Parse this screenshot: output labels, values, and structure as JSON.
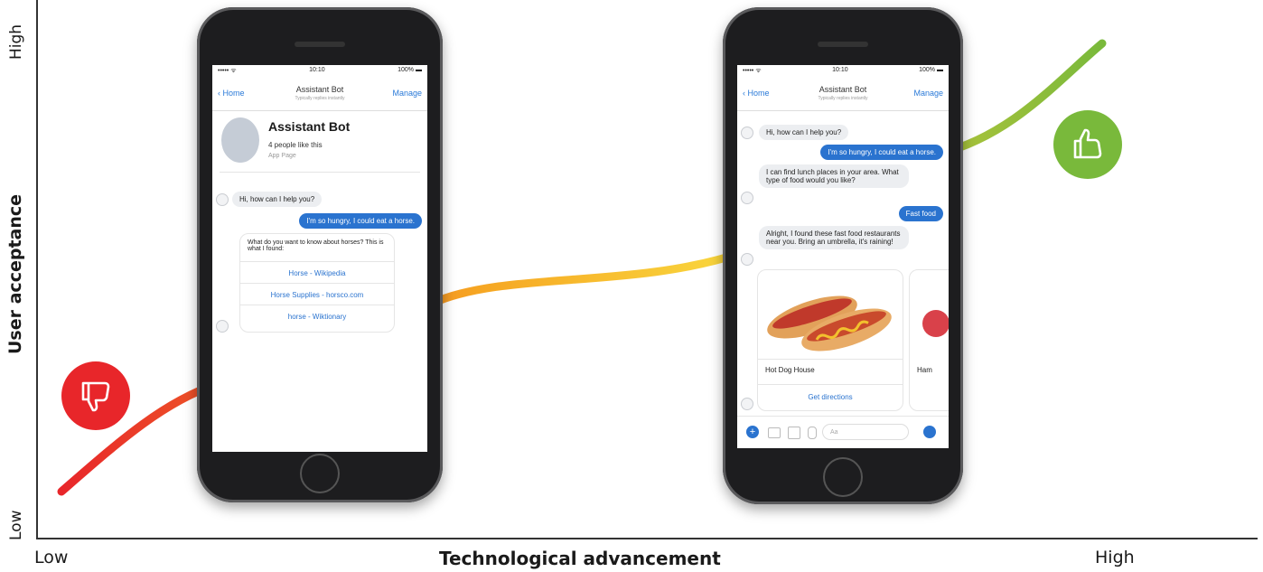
{
  "axes": {
    "y_title": "User acceptance",
    "y_low": "Low",
    "y_high": "High",
    "x_title": "Technological advancement",
    "x_low": "Low",
    "x_high": "High"
  },
  "badges": {
    "low_icon": "thumbs-down-icon",
    "high_icon": "thumbs-up-icon",
    "low_color": "#e8262a",
    "high_color": "#79b93b"
  },
  "curve_colors": [
    "#e8262a",
    "#f6a623",
    "#f9d23b",
    "#79b93b"
  ],
  "phone1": {
    "carrier": "••••• ᯤ",
    "time": "10:10",
    "battery": "100% ▬",
    "back": "‹ Home",
    "title": "Assistant Bot",
    "subtitle": "Typically replies instantly",
    "manage": "Manage",
    "profile_name": "Assistant Bot",
    "profile_likes": "4 people like this",
    "profile_category": "App Page",
    "messages": [
      "Hi, how can I help you?",
      "I'm so hungry, I could eat a horse.",
      "What do you want to know about horses? This is what I found:"
    ],
    "links": [
      "Horse - Wikipedia",
      "Horse Supplies - horsco.com",
      "horse - Wiktionary"
    ]
  },
  "phone2": {
    "carrier": "••••• ᯤ",
    "time": "10:10",
    "battery": "100% ▬",
    "back": "‹ Home",
    "title": "Assistant Bot",
    "subtitle": "Typically replies instantly",
    "manage": "Manage",
    "messages": [
      "Hi, how can I help you?",
      "I'm so hungry, I could eat a horse.",
      "I can find lunch places in your area. What type of food would you like?",
      "Fast food",
      "Alright, I found these fast food restaurants near you. Bring an umbrella, it's raining!"
    ],
    "card_title": "Hot Dog House",
    "card_action": "Get directions",
    "card2_title": "Ham",
    "composer_placeholder": "Aa"
  }
}
